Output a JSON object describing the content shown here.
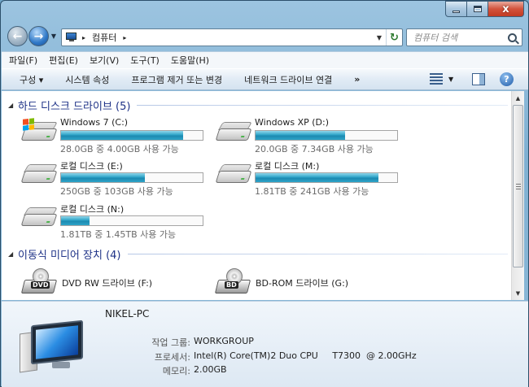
{
  "window": {
    "caption": {
      "minimize": "",
      "maximize": "",
      "close": "x"
    }
  },
  "address": {
    "crumb": "컴퓨터",
    "separator": "▸"
  },
  "search": {
    "placeholder": "컴퓨터 검색"
  },
  "menu": [
    "파일(F)",
    "편집(E)",
    "보기(V)",
    "도구(T)",
    "도움말(H)"
  ],
  "commands": {
    "organize": "구성 ▾",
    "system_props": "시스템 속성",
    "uninstall": "프로그램 제거 또는 변경",
    "map_drive": "네트워크 드라이브 연결",
    "more": "»"
  },
  "groups": {
    "hdd": "하드 디스크 드라이브 (5)",
    "removable": "이동식 미디어 장치 (4)"
  },
  "drives": [
    {
      "name": "Windows 7 (C:)",
      "free": "28.0GB 중 4.00GB 사용 가능",
      "used_fraction": 0.86,
      "icon": "windows-drive-icon"
    },
    {
      "name": "Windows XP (D:)",
      "free": "20.0GB 중 7.34GB 사용 가능",
      "used_fraction": 0.63,
      "icon": "hard-drive-icon"
    },
    {
      "name": "로컬 디스크 (E:)",
      "free": "250GB 중 103GB 사용 가능",
      "used_fraction": 0.59,
      "icon": "hard-drive-icon"
    },
    {
      "name": "로컬 디스크 (M:)",
      "free": "1.81TB 중 241GB 사용 가능",
      "used_fraction": 0.87,
      "icon": "hard-drive-icon"
    },
    {
      "name": "로컬 디스크 (N:)",
      "free": "1.81TB 중 1.45TB 사용 가능",
      "used_fraction": 0.2,
      "icon": "hard-drive-icon"
    }
  ],
  "optical": [
    {
      "name": "DVD RW 드라이브 (F:)",
      "badge": "DVD",
      "icon": "dvd-drive-icon"
    },
    {
      "name": "BD-ROM 드라이브 (G:)",
      "badge": "BD",
      "icon": "bd-drive-icon"
    }
  ],
  "details": {
    "pc_name": "NIKEL-PC",
    "workgroup_label": "작업 그룹:",
    "workgroup": "WORKGROUP",
    "cpu_label": "프로세서:",
    "cpu": "Intel(R) Core(TM)2 Duo CPU     T7300  @ 2.00GHz",
    "memory_label": "메모리:",
    "memory": "2.00GB"
  },
  "colors": {
    "bar_fill": "#2ea4c8",
    "group_title": "#1e3287"
  }
}
